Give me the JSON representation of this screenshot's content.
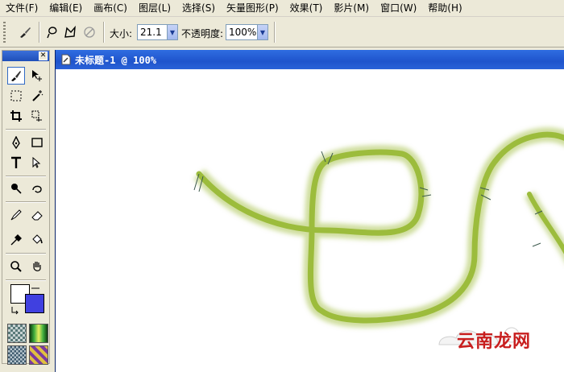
{
  "menu": [
    {
      "id": "file",
      "label": "文件(F)"
    },
    {
      "id": "edit",
      "label": "编辑(E)"
    },
    {
      "id": "canvas",
      "label": "画布(C)"
    },
    {
      "id": "layer",
      "label": "图层(L)"
    },
    {
      "id": "select",
      "label": "选择(S)"
    },
    {
      "id": "vector",
      "label": "矢量图形(P)"
    },
    {
      "id": "effects",
      "label": "效果(T)"
    },
    {
      "id": "movie",
      "label": "影片(M)"
    },
    {
      "id": "window",
      "label": "窗口(W)"
    },
    {
      "id": "help",
      "label": "帮助(H)"
    }
  ],
  "options": {
    "size_label": "大小:",
    "size_value": "21.1",
    "opacity_label": "不透明度:",
    "opacity_value": "100%"
  },
  "document": {
    "title": "未标题-1 @ 100%"
  },
  "colors": {
    "foreground": "#4040e0",
    "background": "#ffffff",
    "stroke": "#9cbc3c",
    "titlebar": "#2458d4"
  },
  "watermark": {
    "text": "云南龙网"
  }
}
